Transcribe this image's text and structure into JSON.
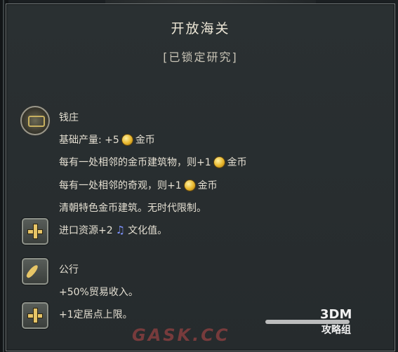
{
  "tooltip": {
    "title": "开放海关",
    "status": "[已锁定研究]"
  },
  "bank": {
    "name": "钱庄",
    "base_yield_prefix": "基础产量: +5",
    "base_yield_suffix": "金币",
    "adjacency_gold_prefix": "每有一处相邻的金币建筑物，则+1",
    "adjacency_gold_suffix": "金币",
    "adjacency_wonder_prefix": "每有一处相邻的奇观，则+1",
    "adjacency_wonder_suffix": "金币",
    "description": "清朝特色金币建筑。无时代限制。",
    "import_bonus": "进口资源+2",
    "import_bonus_suffix": "文化值。"
  },
  "trading_house": {
    "name": "公行",
    "trade_bonus": "+50%贸易收入。",
    "settlement_bonus": "+1定居点上限。"
  },
  "watermarks": {
    "brand_top": "3DM",
    "brand_bottom": "攻略组",
    "site": "GASK.CC"
  },
  "icons": [
    "bank-icon",
    "plus-icon",
    "feather-icon",
    "gold-coin-icon",
    "culture-note-icon"
  ],
  "colors": {
    "panel_bg": "#282d2f",
    "border": "#767c7d",
    "text": "#e4dfd2",
    "gold": "#e7b52a",
    "culture": "#7f94ff"
  }
}
